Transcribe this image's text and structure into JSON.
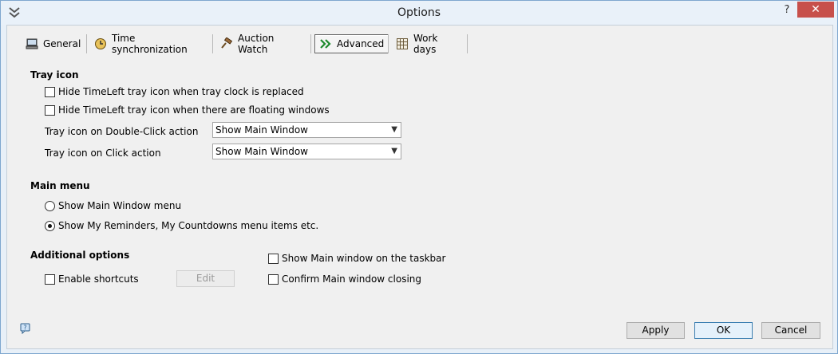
{
  "window": {
    "title": "Options",
    "help_label": "?",
    "close_label": "✕"
  },
  "tabs": [
    {
      "label": "General",
      "icon": "computer-icon"
    },
    {
      "label": "Time synchronization",
      "icon": "clock-globe-icon"
    },
    {
      "label": "Auction Watch",
      "icon": "gavel-icon"
    },
    {
      "label": "Advanced",
      "icon": "double-chevron-icon",
      "active": true
    },
    {
      "label": "Work days",
      "icon": "calendar-grid-icon"
    }
  ],
  "tray": {
    "title": "Tray icon",
    "hide_replaced": "Hide TimeLeft tray icon when tray clock is replaced",
    "hide_floating": "Hide TimeLeft tray icon when there are floating windows",
    "dblclick_label": "Tray icon on Double-Click action",
    "dblclick_value": "Show Main Window",
    "click_label": "Tray icon on Click action",
    "click_value": "Show Main Window"
  },
  "main_menu": {
    "title": "Main menu",
    "option1": "Show Main Window menu",
    "option2": "Show My Reminders, My Countdowns menu  items etc."
  },
  "additional": {
    "title": "Additional options",
    "enable_shortcuts": "Enable shortcuts",
    "edit_label": "Edit",
    "show_taskbar": "Show Main window on the taskbar",
    "confirm_closing": "Confirm Main window closing"
  },
  "buttons": {
    "apply": "Apply",
    "ok": "OK",
    "cancel": "Cancel"
  },
  "colors": {
    "accent": "#3c7fb1",
    "close": "#c7504b"
  }
}
